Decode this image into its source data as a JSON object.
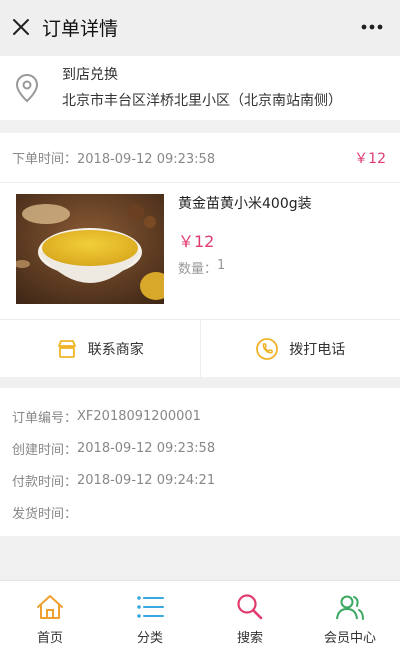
{
  "header": {
    "title": "订单详情"
  },
  "address": {
    "mode": "到店兑换",
    "text": "北京市丰台区洋桥北里小区（北京南站南侧）"
  },
  "order": {
    "time_label": "下单时间：",
    "time_value": "2018-09-12 09:23:58",
    "total": "￥12"
  },
  "product": {
    "name": "黄金苗黄小米400g装",
    "price": "￥12",
    "qty_label": "数量：",
    "qty_value": "1"
  },
  "actions": {
    "contact": "联系商家",
    "call": "拨打电话"
  },
  "details": [
    {
      "label": "订单编号：",
      "value": "XF2018091200001"
    },
    {
      "label": "创建时间：",
      "value": "2018-09-12 09:23:58"
    },
    {
      "label": "付款时间：",
      "value": "2018-09-12 09:24:21"
    },
    {
      "label": "发货时间：",
      "value": ""
    }
  ],
  "tabs": [
    {
      "label": "首页",
      "icon": "home-icon",
      "color": "#f0a030"
    },
    {
      "label": "分类",
      "icon": "list-icon",
      "color": "#3aa7e0"
    },
    {
      "label": "搜索",
      "icon": "search-icon",
      "color": "#e03c6e"
    },
    {
      "label": "会员中心",
      "icon": "user-icon",
      "color": "#3aa860"
    }
  ],
  "colors": {
    "accent": "#e03c6e",
    "contact_icon": "#f0b429",
    "call_icon": "#f0b429"
  }
}
